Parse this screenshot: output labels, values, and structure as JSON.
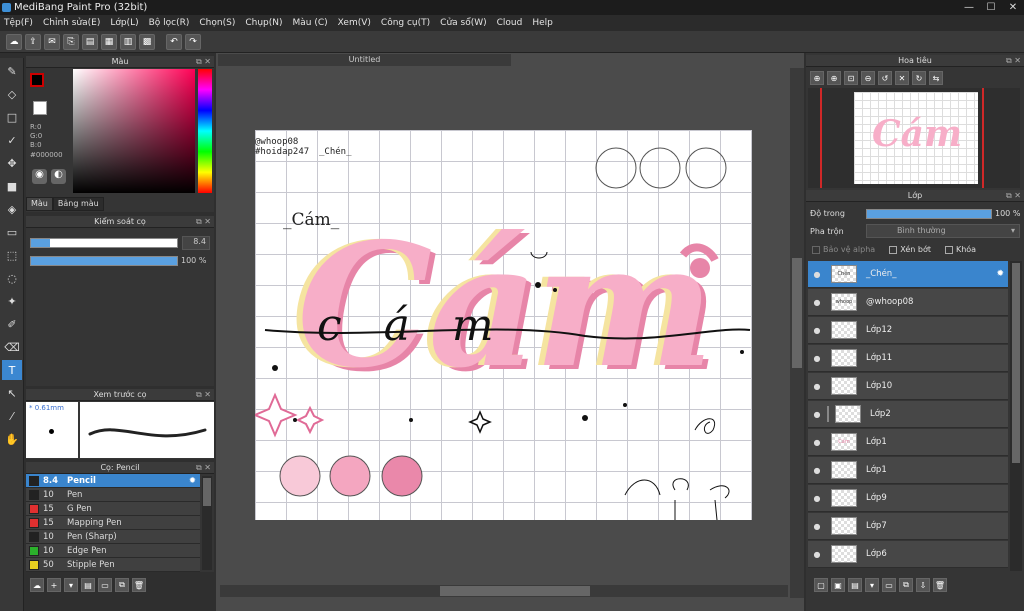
{
  "app": {
    "title": "MediBang Paint Pro (32bit)",
    "win_min": "—",
    "win_max": "☐",
    "win_close": "✕"
  },
  "menu": [
    "Tệp(F)",
    "Chỉnh sửa(E)",
    "Lớp(L)",
    "Bộ lọc(R)",
    "Chọn(S)",
    "Chụp(N)",
    "Màu (C)",
    "Xem(V)",
    "Công cụ(T)",
    "Cửa sổ(W)",
    "Cloud",
    "Help"
  ],
  "toolbar_icons": [
    "cloud-icon",
    "upload-icon",
    "comment-icon",
    "share-icon",
    "document-icon",
    "grid-icon",
    "layout-icon",
    "tiles-icon",
    "undo-icon",
    "redo-icon"
  ],
  "tools": [
    "brush-icon",
    "eraser-icon",
    "rect-select-icon",
    "pen-icon",
    "move-icon",
    "fill-rect-icon",
    "bucket-icon",
    "gradient-icon",
    "select-icon",
    "lasso-icon",
    "magic-wand-icon",
    "select-pen-icon",
    "select-eraser-icon",
    "text-icon",
    "operation-icon",
    "eyedropper-icon",
    "hand-icon"
  ],
  "color_panel": {
    "title": "Màu",
    "r": "R:0",
    "g": "G:0",
    "b": "B:0",
    "hex": "#000000",
    "tab_color": "Màu",
    "tab_palette": "Bảng màu",
    "fg": "#000000",
    "bg": "#ffffff"
  },
  "brush_control": {
    "title": "Kiểm soát cọ",
    "size": "8.4",
    "opacity": "100 %",
    "size_fraction": 0.13,
    "opacity_fraction": 1.0
  },
  "brush_preview": {
    "title": "Xem trước cọ",
    "size_label": "* 0.61mm"
  },
  "brush_list": {
    "title": "Cọ: Pencil",
    "items": [
      {
        "size": "8.4",
        "name": "Pencil",
        "color": "#222222",
        "selected": true
      },
      {
        "size": "10",
        "name": "Pen",
        "color": "#222222"
      },
      {
        "size": "15",
        "name": "G Pen",
        "color": "#e03030"
      },
      {
        "size": "15",
        "name": "Mapping Pen",
        "color": "#e03030"
      },
      {
        "size": "10",
        "name": "Pen (Sharp)",
        "color": "#222222"
      },
      {
        "size": "10",
        "name": "Edge Pen",
        "color": "#2bb02b"
      },
      {
        "size": "50",
        "name": "Stipple Pen",
        "color": "#e8d020"
      }
    ]
  },
  "document": {
    "tab": "Untitled",
    "text_handle1": "@whoop08",
    "text_handle2": "#hoidap247",
    "text_chen": "_Chén_",
    "text_cam": "_Cám_",
    "big_title": "Cám",
    "script_word": "c  á  m"
  },
  "navigator": {
    "title": "Hoa tiêu"
  },
  "layers": {
    "title": "Lớp",
    "opacity_label": "Độ trong",
    "opacity_value": "100 %",
    "blend_label": "Pha trộn",
    "blend_value": "Bình thường",
    "protect_alpha": "Bảo vệ alpha",
    "clip": "Xén bớt",
    "lock": "Khóa",
    "items": [
      {
        "name": "_Chén_",
        "thumb": "Chén",
        "selected": true
      },
      {
        "name": "@whoop08",
        "thumb": "whoop"
      },
      {
        "name": "Lớp12",
        "thumb": ""
      },
      {
        "name": "Lớp11",
        "thumb": ""
      },
      {
        "name": "Lớp10",
        "thumb": ""
      },
      {
        "name": "Lớp2",
        "thumb": "",
        "indent": true
      },
      {
        "name": "Lớp1",
        "thumb": "Cám"
      },
      {
        "name": "Lớp1",
        "thumb": ""
      },
      {
        "name": "Lớp9",
        "thumb": ""
      },
      {
        "name": "Lớp7",
        "thumb": ""
      },
      {
        "name": "Lớp6",
        "thumb": ""
      }
    ]
  }
}
